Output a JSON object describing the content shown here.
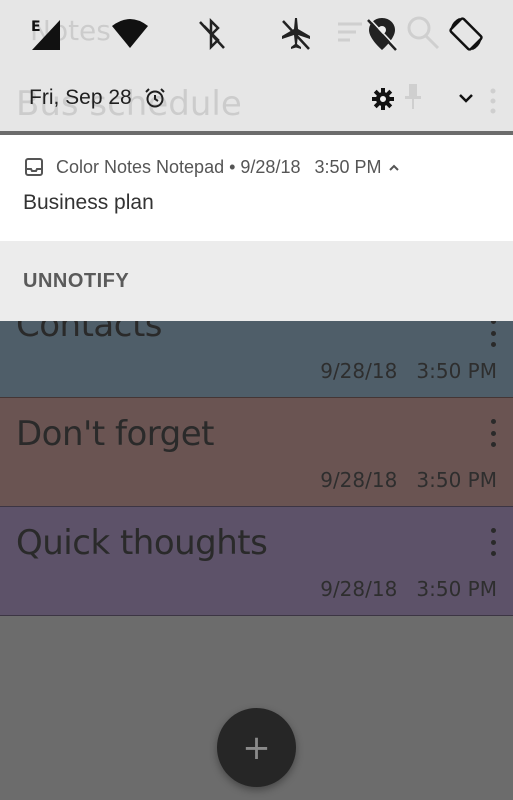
{
  "status_bar": {
    "icons": [
      "signal-e-icon",
      "wifi-icon",
      "bluetooth-off-icon",
      "airplane-off-icon",
      "location-off-icon",
      "auto-rotate-icon"
    ],
    "signal_label": "E"
  },
  "background_app": {
    "title_ghost": "Notes",
    "note_ghost": "Bus schedule",
    "notes": [
      {
        "title": "Contacts",
        "date": "9/28/18",
        "time": "3:50 PM",
        "color": "#4f5e69"
      },
      {
        "title": "Don't forget",
        "date": "9/28/18",
        "time": "3:50 PM",
        "color": "#6a5452"
      },
      {
        "title": "Quick thoughts",
        "date": "9/28/18",
        "time": "3:50 PM",
        "color": "#5d5269"
      }
    ],
    "fab_icon": "+"
  },
  "shade": {
    "date": "Fri, Sep 28"
  },
  "notification": {
    "app_name": "Color Notes Notepad",
    "separator": "•",
    "date": "9/28/18",
    "time": "3:50 PM",
    "body": "Business plan",
    "action": "UNNOTIFY"
  },
  "colors": {
    "shade_bg": "#eeeeee",
    "card_bg": "#ffffff",
    "action_bg": "#ececec",
    "fab_bg": "#262626"
  }
}
